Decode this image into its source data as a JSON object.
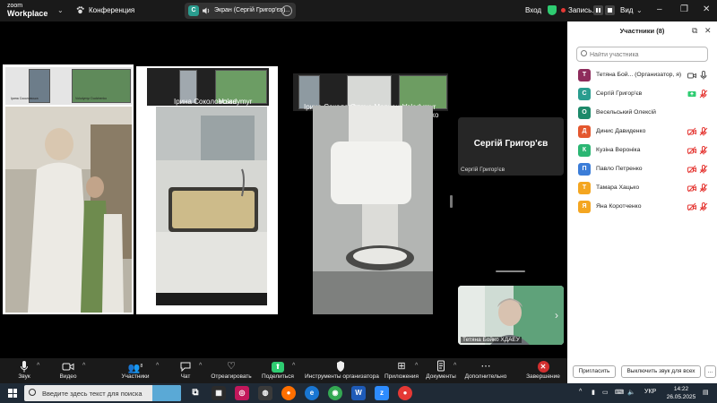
{
  "app": {
    "logo_line1": "zoom",
    "logo_line2": "Workplace"
  },
  "topbar": {
    "conference_label": "Конференция",
    "share_letter": "С",
    "share_title": "Экран (Сергій Григор'єв)",
    "login_label": "Вход",
    "recording_label": "Запись...",
    "view_label": "Вид"
  },
  "video_tiles": [
    {
      "big_name": "Сергій Григор'єв",
      "small_name": "Сергій Григор'єв"
    },
    {
      "small_name": "Тетяна Бойко ХДАЕУ"
    }
  ],
  "shared_screen": {
    "thumb_names": [
      "Ірина Соколовська",
      "Volodymyr Dudchenko",
      "Ірина Соколовська",
      "Volodymyr Dudchenko",
      "Ірина Соколовська",
      "Олена Марченко",
      "Volodymyr Dudchenko"
    ]
  },
  "participants": {
    "title": "Участники (8)",
    "search_placeholder": "Найти участника",
    "list": [
      {
        "letter": "Т",
        "name": "Тетяна Бой...  (Организатор, я)",
        "color": "#8e2c5c",
        "mic": "on",
        "cam": "on"
      },
      {
        "letter": "С",
        "name": "Сергій Григор'єв",
        "color": "#2a9d8f",
        "mic": "off",
        "cam": "share"
      },
      {
        "letter": "О",
        "name": "Весельський Олексій",
        "color": "#1d8a6a",
        "mic": "none",
        "cam": "none"
      },
      {
        "letter": "Д",
        "name": "Динис Давиденко",
        "color": "#e4572e",
        "mic": "off",
        "cam": "off"
      },
      {
        "letter": "К",
        "name": "Кузіна Вероніка",
        "color": "#2bb673",
        "mic": "off",
        "cam": "off"
      },
      {
        "letter": "П",
        "name": "Павло Петренко",
        "color": "#3b7dd8",
        "mic": "off",
        "cam": "off"
      },
      {
        "letter": "Т",
        "name": "Тамара Хацько",
        "color": "#f4a621",
        "mic": "off",
        "cam": "off"
      },
      {
        "letter": "Я",
        "name": "Яна Коротченко",
        "color": "#f4a621",
        "mic": "off",
        "cam": "off"
      }
    ],
    "invite_label": "Пригласить",
    "mute_all_label": "Выключить звук для всех",
    "more_label": "..."
  },
  "controls": {
    "audio": "Звук",
    "video": "Видео",
    "participants": "Участники",
    "participants_count": "8",
    "chat": "Чат",
    "react": "Отреагировать",
    "share": "Поделиться",
    "host_tools": "Инструменты организатора",
    "apps": "Приложения",
    "docs": "Документы",
    "more": "Дополнительно",
    "end": "Завершение"
  },
  "taskbar": {
    "search_placeholder": "Введите здесь текст для поиска",
    "lang": "УКР",
    "time": "14:22",
    "date": "26.05.2025"
  },
  "colors": {
    "accent_green": "#2ecc71",
    "record_red": "#e53935",
    "muted_red": "#e53935"
  }
}
